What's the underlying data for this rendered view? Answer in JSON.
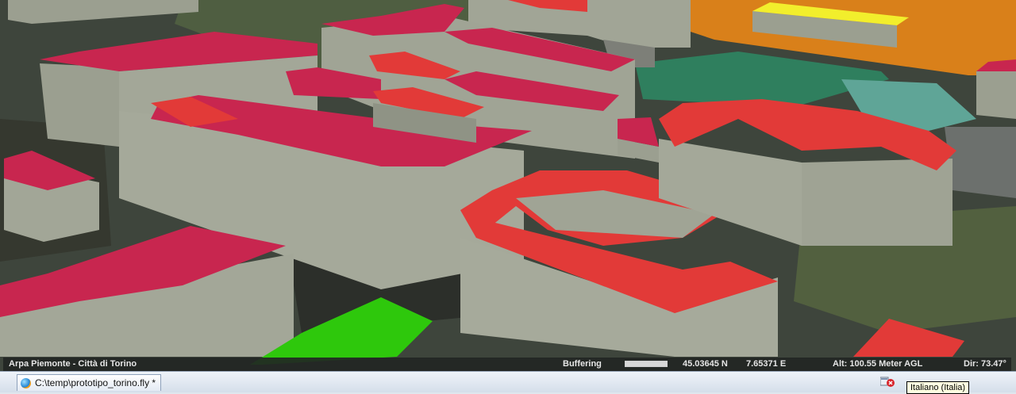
{
  "status": {
    "credits": "Arpa Piemonte - Città di Torino",
    "buffering_label": "Buffering",
    "buffering_progress": 1.0,
    "latitude": "45.03645 N",
    "longitude": "7.65371 E",
    "altitude": "Alt: 100.55 Meter AGL",
    "direction": "Dir: 73.47°"
  },
  "taskbar": {
    "document_title": "C:\\temp\\prototipo_torino.fly *",
    "tray_error_icon": "error-icon"
  },
  "tooltip": {
    "language": "Italiano (Italia)"
  },
  "colors": {
    "roof_crimson": "#c8264f",
    "roof_red": "#e23a38",
    "roof_green": "#2ec80c",
    "roof_yellow": "#f2ee2c",
    "wall_gray": "#9b9f90",
    "zone_orange": "#d9801a"
  }
}
